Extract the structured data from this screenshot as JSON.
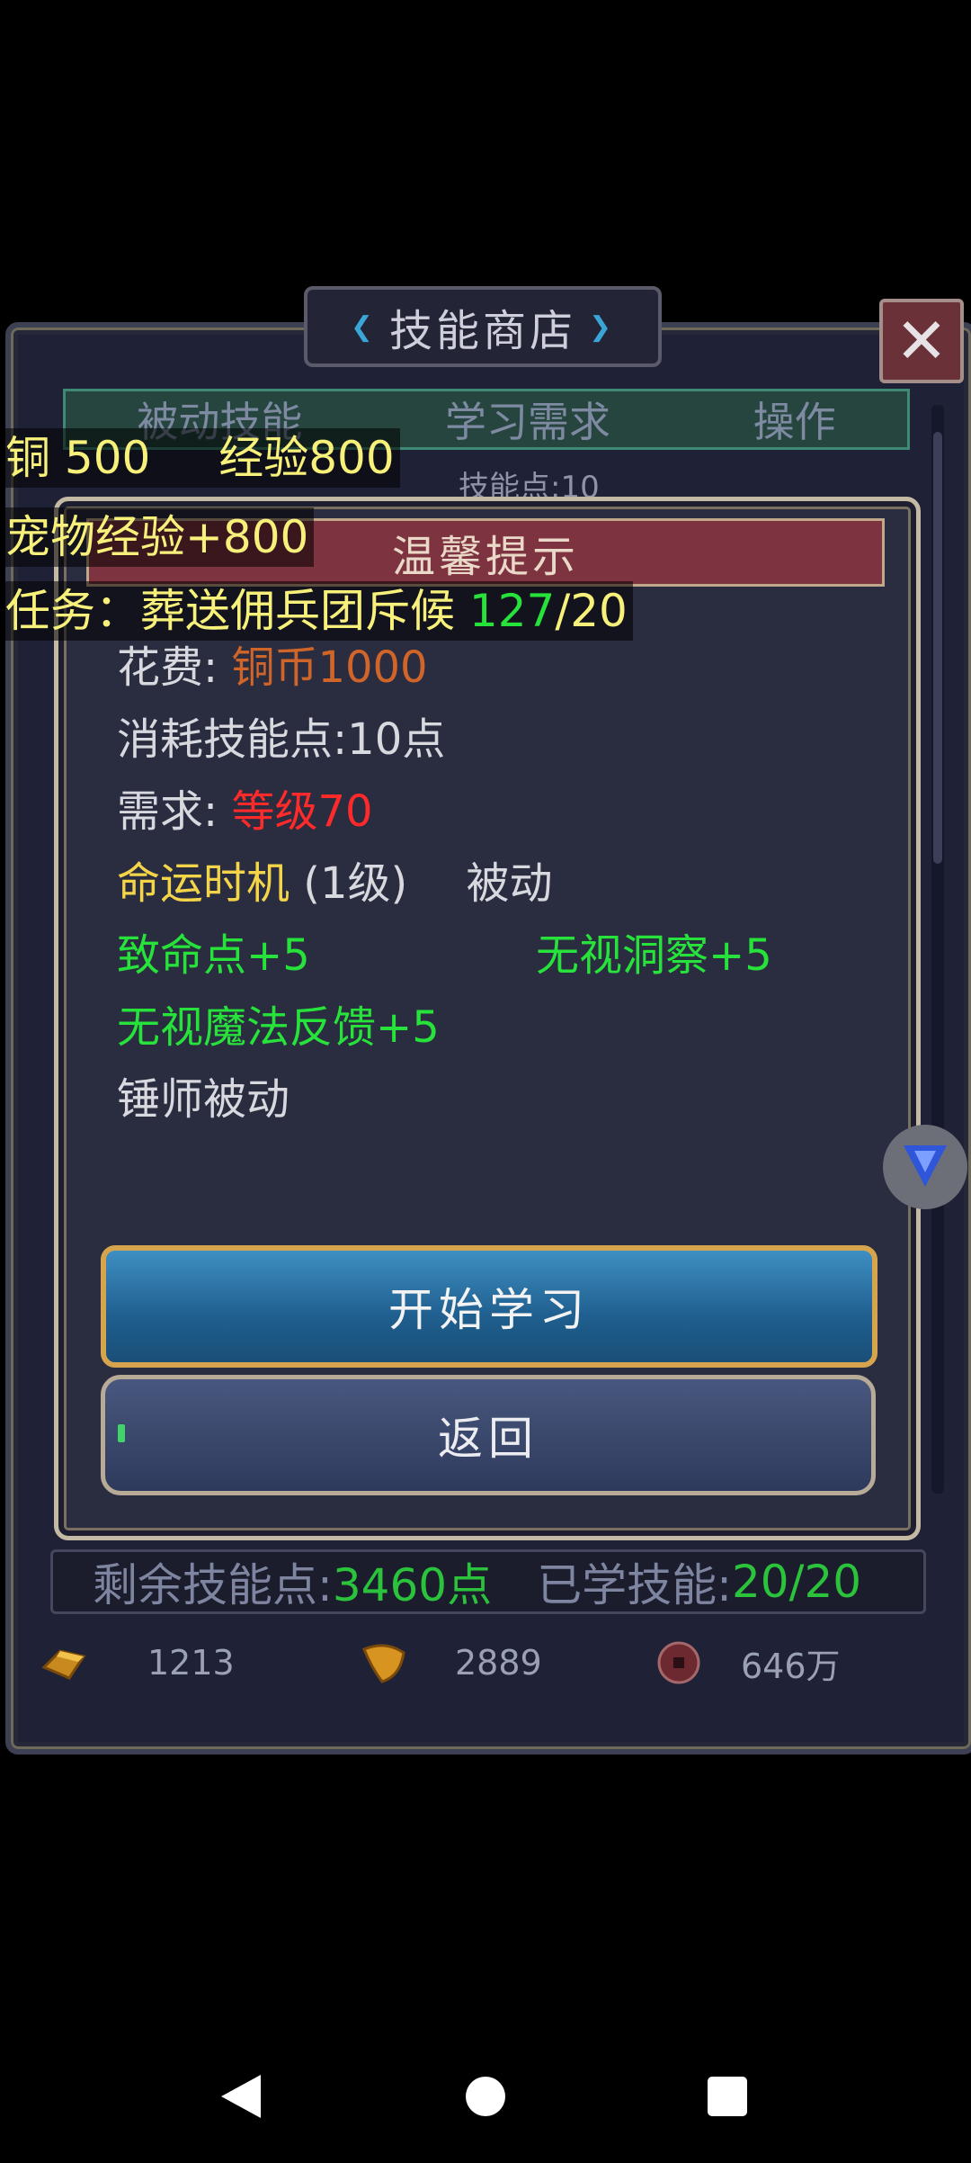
{
  "panel": {
    "title": "技能商店",
    "close_label": "✕",
    "tabs": [
      "被动技能",
      "学习需求",
      "操作"
    ],
    "row_peek": "技能点:10"
  },
  "hud": {
    "copper": "铜 500",
    "exp": "经验800",
    "pet_exp": "宠物经验+800",
    "task_prefix": "任务：葬送佣兵团斥候",
    "task_done": "127",
    "task_total": "/20"
  },
  "modal": {
    "title": "温馨提示",
    "cost_label": "花费: ",
    "cost_value": "铜币1000",
    "consume": "消耗技能点:10点",
    "req_label": "需求: ",
    "req_value": "等级70",
    "skill_name": "命运时机",
    "skill_level": "(1级)",
    "skill_type": "被动",
    "attr1": "致命点+5",
    "attr2": "无视洞察+5",
    "attr3": "无视魔法反馈+5",
    "desc": "锤师被动",
    "learn_button": "开始学习",
    "back_button": "返回"
  },
  "footer": {
    "remaining_label": "剩余技能点: ",
    "remaining_value": "3460点",
    "learned_label": "已学技能:",
    "learned_value": "20/20",
    "gold": "1213",
    "leaf": "2889",
    "coin": "646万"
  },
  "colors": {
    "green": "#27e23a",
    "red": "#ff2a2a",
    "orange": "#d0652a",
    "yellow": "#f4d54a"
  },
  "icons": [
    "close-icon",
    "gold-ingot-icon",
    "leaf-icon",
    "copper-coin-icon",
    "assistant-icon",
    "back-nav-icon",
    "home-nav-icon",
    "recents-nav-icon"
  ]
}
